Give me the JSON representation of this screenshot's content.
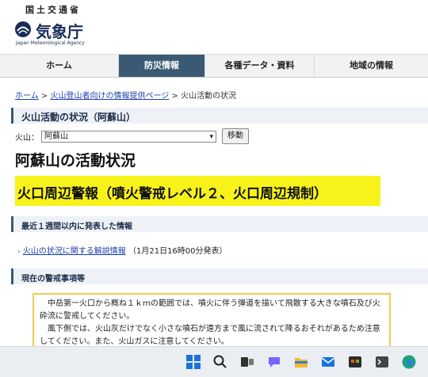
{
  "header": {
    "ministry": "国土交通省",
    "agency_name": "気象庁",
    "agency_name_en": "Japan Meteorological Agency"
  },
  "nav": [
    {
      "label": "ホーム",
      "active": false
    },
    {
      "label": "防災情報",
      "active": true
    },
    {
      "label": "各種データ・資料",
      "active": false
    },
    {
      "label": "地域の情報",
      "active": false
    }
  ],
  "breadcrumb": {
    "home": "ホーム",
    "sep1": ">",
    "link": "火山登山者向けの情報提供ページ",
    "sep2": ">",
    "current": "火山活動の状況"
  },
  "status_title": "火山活動の状況（阿蘇山）",
  "volcano_select": {
    "label": "火山：",
    "value": "阿蘇山",
    "button": "移動"
  },
  "page_title": "阿蘇山の活動状況",
  "alert_banner": "火口周辺警報（噴火警戒レベル２、火口周辺規制）",
  "recent": {
    "heading": "最近１週間以内に発表した情報",
    "link_text": "火山の状況に関する解説情報",
    "link_date": "（1月21日16時00分発表）"
  },
  "warning": {
    "heading": "現在の警戒事項等",
    "paragraphs": [
      "中岳第一火口から概ね１ｋｍの範囲では、噴火に伴う弾道を描いて飛散する大きな噴石及び火砕流に警戒してください。",
      "風下側では、火山灰だけでなく小さな噴石が遠方まで風に流されて降るおそれがあるため注意してください。また、火山ガスに注意してください。"
    ]
  },
  "colors": {
    "nav_active": "#3a5a73",
    "alert_yellow": "#f7f21a",
    "link": "#1a3fa8",
    "warn_border": "#f2c94c"
  },
  "taskbar": {
    "icons": [
      "windows-start-icon",
      "search-icon",
      "task-view-icon",
      "chat-icon",
      "file-explorer-icon",
      "mail-icon",
      "store-icon",
      "edge-icon"
    ]
  }
}
